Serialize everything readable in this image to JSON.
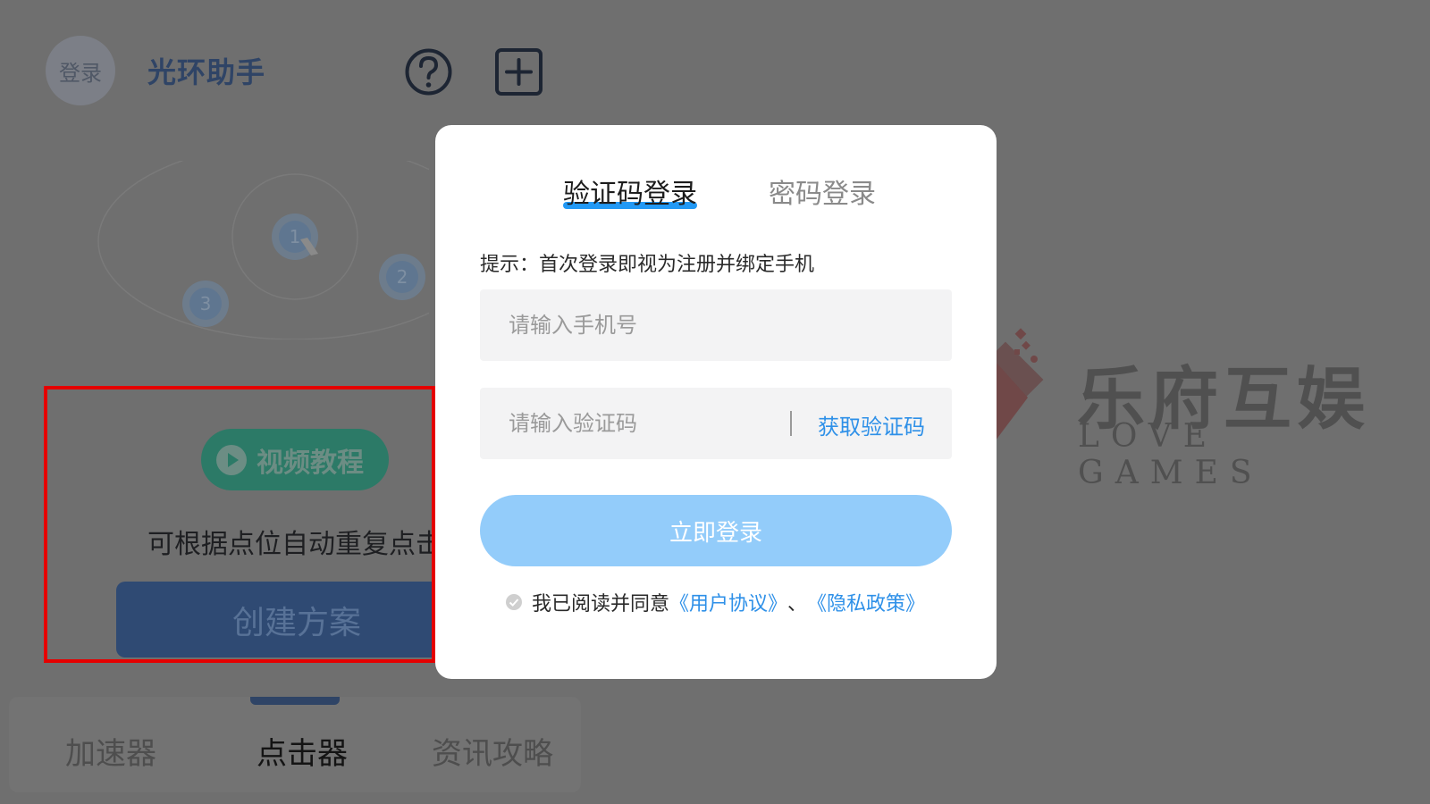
{
  "header": {
    "login_avatar": "登录",
    "app_title": "光环助手",
    "help_icon": "question-circle-icon",
    "add_icon": "plus-square-icon"
  },
  "illustration": {
    "markers": [
      "1",
      "2",
      "3"
    ]
  },
  "clicker_panel": {
    "video_button": "视频教程",
    "description": "可根据点位自动重复点击",
    "create_button": "创建方案"
  },
  "bottom_tabs": [
    {
      "label": "加速器",
      "active": false
    },
    {
      "label": "点击器",
      "active": true
    },
    {
      "label": "资讯攻略",
      "active": false
    }
  ],
  "watermark": {
    "cn": "乐府互娱",
    "en": "LOVE GAMES"
  },
  "login_modal": {
    "tabs": [
      {
        "label": "验证码登录",
        "active": true
      },
      {
        "label": "密码登录",
        "active": false
      }
    ],
    "hint": "提示：首次登录即视为注册并绑定手机",
    "phone_placeholder": "请输入手机号",
    "code_placeholder": "请输入验证码",
    "get_code": "获取验证码",
    "login_button": "立即登录",
    "agree_prefix": "我已阅读并同意",
    "user_agreement": "《用户协议》",
    "separator": "、",
    "privacy_policy": "《隐私政策》"
  },
  "colors": {
    "overlay_bg": "#6f6f6f",
    "accent_blue": "#2e90e8",
    "login_button": "#93ccfa",
    "highlight_frame": "#e50000"
  }
}
